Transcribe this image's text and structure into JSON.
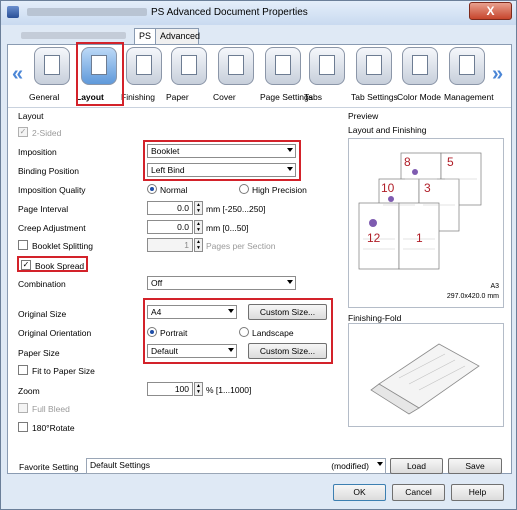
{
  "window": {
    "title": "PS Advanced Document Properties",
    "close": "X"
  },
  "tabs": [
    {
      "label": "PS"
    },
    {
      "label": "Advanced"
    }
  ],
  "toolbar": {
    "left_arrow": "«",
    "right_arrow": "»",
    "items": [
      {
        "label": "General"
      },
      {
        "label": "Layout"
      },
      {
        "label": "Finishing"
      },
      {
        "label": "Paper"
      },
      {
        "label": "Cover"
      },
      {
        "label": "Page Settings"
      },
      {
        "label": "Tabs"
      },
      {
        "label": "Tab Settings"
      },
      {
        "label": "Color Mode"
      },
      {
        "label": "Management"
      }
    ]
  },
  "layout": {
    "section": "Layout",
    "two_sided": "2-Sided",
    "imposition": {
      "label": "Imposition",
      "value": "Booklet"
    },
    "binding": {
      "label": "Binding Position",
      "value": "Left Bind"
    },
    "quality": {
      "label": "Imposition Quality",
      "normal": "Normal",
      "high": "High Precision"
    },
    "page_interval": {
      "label": "Page Interval",
      "value": "0.0",
      "unit": "mm [-250...250]"
    },
    "creep": {
      "label": "Creep Adjustment",
      "value": "0.0",
      "unit": "mm [0...50]"
    },
    "splitting": {
      "label": "Booklet Splitting",
      "value": "1",
      "unit": "Pages per Section"
    },
    "book_spread": "Book Spread",
    "combination": {
      "label": "Combination",
      "value": "Off"
    },
    "original_size": {
      "label": "Original Size",
      "value": "A4",
      "button": "Custom Size..."
    },
    "orientation": {
      "label": "Original Orientation",
      "portrait": "Portrait",
      "landscape": "Landscape"
    },
    "paper_size": {
      "label": "Paper Size",
      "value": "Default",
      "button": "Custom Size..."
    },
    "fit": "Fit to Paper Size",
    "zoom": {
      "label": "Zoom",
      "value": "100",
      "unit": "% [1...1000]"
    },
    "full_bleed": "Full Bleed",
    "rotate": "180°Rotate"
  },
  "preview": {
    "title": "Preview",
    "subtitle": "Layout and Finishing",
    "pages": [
      "8",
      "5",
      "10",
      "3",
      "12",
      "1"
    ],
    "size_name": "A3",
    "size_dims": "297.0x420.0 mm",
    "fold_title": "Finishing-Fold"
  },
  "footer": {
    "favorite_label": "Favorite Setting",
    "favorite_value": "Default Settings",
    "modified": "(modified)",
    "load": "Load",
    "save": "Save",
    "ok": "OK",
    "cancel": "Cancel",
    "help": "Help"
  }
}
